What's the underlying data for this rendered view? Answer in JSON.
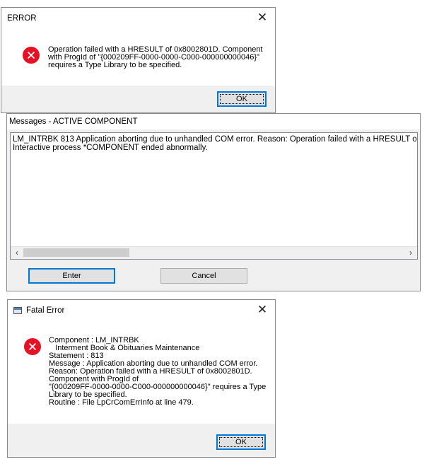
{
  "error_dialog": {
    "title": "ERROR",
    "message_lines": [
      "Operation failed with a HRESULT of 0x8002801D. Component",
      "with ProgId of \"{000209FF-0000-0000-C000-000000000046}\"",
      "requires a Type Library to be specified."
    ],
    "ok_label": "OK"
  },
  "messages_dialog": {
    "title": "Messages - ACTIVE COMPONENT",
    "lines": [
      "LM_INTRBK 813 Application aborting due to unhandled COM error. Reason: Operation failed with a HRESULT of 0x8",
      "Interactive process *COMPONENT ended abnormally."
    ],
    "enter_label": "Enter",
    "cancel_label": "Cancel"
  },
  "fatal_dialog": {
    "title": "Fatal Error",
    "message_lines": [
      "Component : LM_INTRBK",
      "   Interment Book & Obituaries Maintenance",
      "Statement : 813",
      "Message : Application aborting due to unhandled COM error.",
      "Reason: Operation failed with a HRESULT of 0x8002801D.",
      "Component with ProgId of",
      "\"{000209FF-0000-0000-C000-000000000046}\" requires a Type",
      "Library to be specified.",
      "Routine : File LpCrComErrInfo at line 479."
    ],
    "ok_label": "OK"
  },
  "icons": {
    "error": "error-icon",
    "close": "close-icon",
    "app": "app-window-icon",
    "scroll_left": "chevron-left-icon",
    "scroll_right": "chevron-right-icon"
  },
  "colors": {
    "error_red": "#e81123",
    "dialog_bg": "#f0f0f0",
    "focus_blue": "#0078d7"
  }
}
